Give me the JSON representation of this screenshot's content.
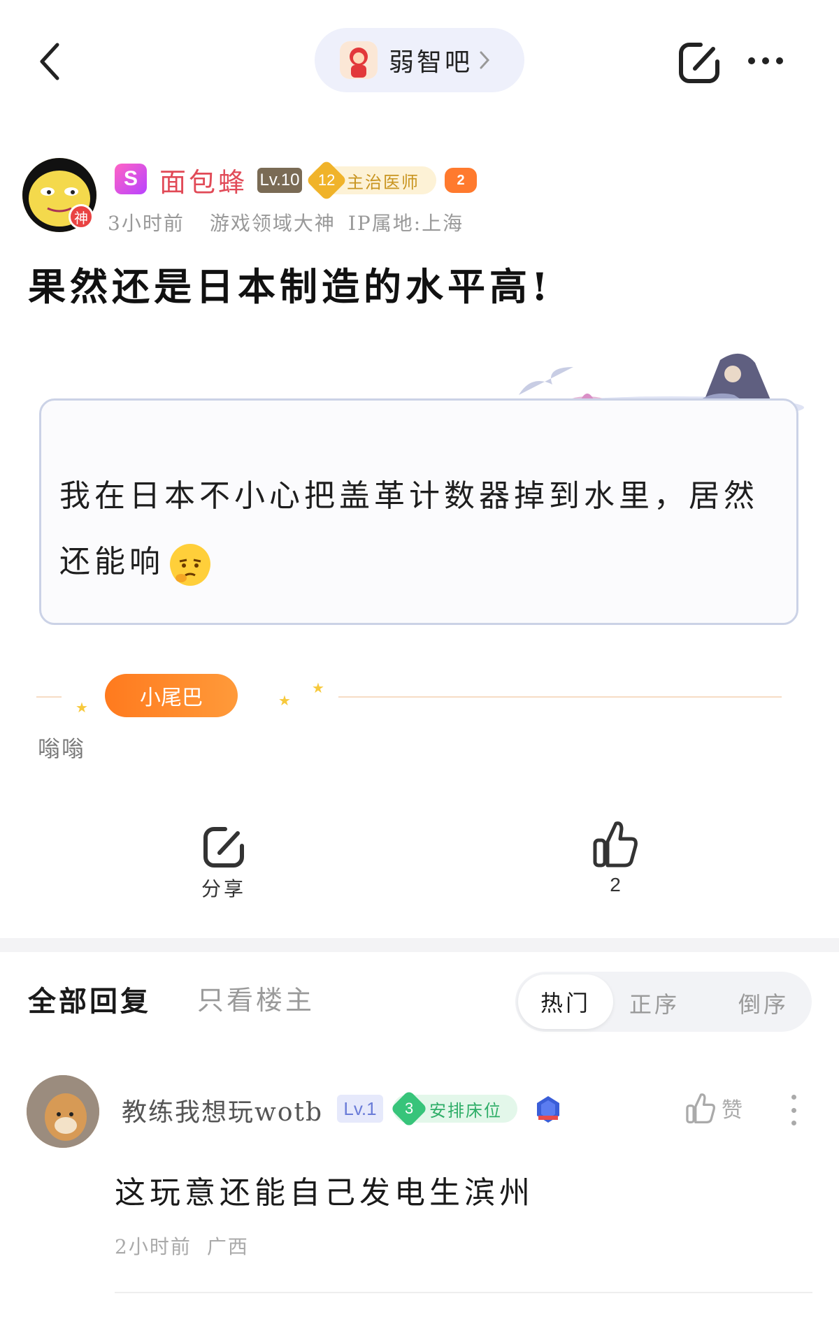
{
  "forum": {
    "name": "弱智吧"
  },
  "post": {
    "author": {
      "name": "面包蜂",
      "vip": "S",
      "level": "Lv.10",
      "rank_number": "12",
      "rank_title": "主治医师",
      "game_badge": "2",
      "avatar_badge": "神"
    },
    "time": "3小时前",
    "tag": "游戏领域大神",
    "ip": "IP属地:上海",
    "title": "果然还是日本制造的水平高!",
    "body": "我在日本不小心把盖革计数器掉到水里，居然还能响",
    "tail_label": "小尾巴",
    "tail_text": "嗡嗡",
    "share_label": "分享",
    "like_count": "2"
  },
  "replies": {
    "tab_all": "全部回复",
    "tab_owner": "只看楼主",
    "sort": {
      "hot": "热门",
      "asc": "正序",
      "desc": "倒序"
    },
    "items": [
      {
        "user": "教练我想玩wotb",
        "level": "Lv.1",
        "rank_number": "3",
        "rank_title": "安排床位",
        "text": "这玩意还能自己发电生滨州",
        "time": "2小时前",
        "location": "广西",
        "like_label": "赞"
      }
    ]
  },
  "colors": {
    "author_name": "#e14a57",
    "forum_pill": "#eef0fb",
    "card_border": "#cbd2e6",
    "tail_badge": "#ff7a1e"
  }
}
